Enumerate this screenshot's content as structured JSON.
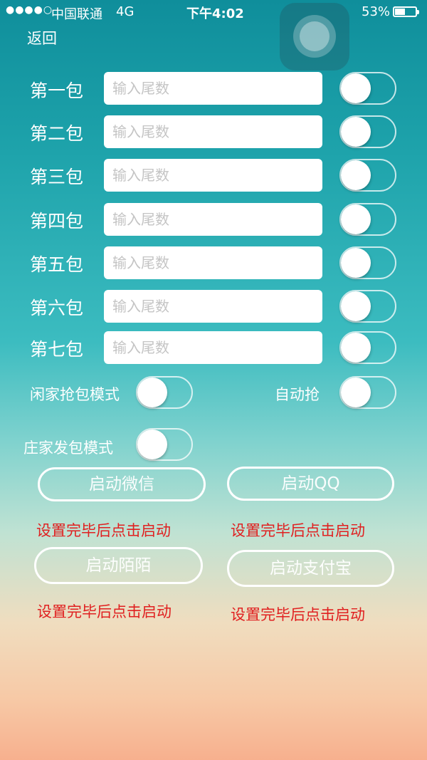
{
  "status_bar": {
    "signal": "●●●●○",
    "carrier": "中国联通",
    "network": "4G",
    "time": "下午4:02",
    "battery": "53%",
    "battery_level": 0.53
  },
  "nav": {
    "back_label": "返回"
  },
  "packets": [
    {
      "label": "第一包",
      "placeholder": "输入尾数",
      "enabled": false
    },
    {
      "label": "第二包",
      "placeholder": "输入尾数",
      "enabled": false
    },
    {
      "label": "第三包",
      "placeholder": "输入尾数",
      "enabled": false
    },
    {
      "label": "第四包",
      "placeholder": "输入尾数",
      "enabled": false
    },
    {
      "label": "第五包",
      "placeholder": "输入尾数",
      "enabled": false
    },
    {
      "label": "第六包",
      "placeholder": "输入尾数",
      "enabled": false
    },
    {
      "label": "第七包",
      "placeholder": "输入尾数",
      "enabled": false
    }
  ],
  "modes": {
    "idle_mode_label": "闲家抢包模式",
    "auto_grab_label": "自动抢",
    "banker_mode_label": "庄家发包模式"
  },
  "launch": {
    "wechat": {
      "label": "启动微信",
      "hint": "设置完毕后点击启动"
    },
    "qq": {
      "label": "启动QQ",
      "hint": "设置完毕后点击启动"
    },
    "momo": {
      "label": "启动陌陌",
      "hint": "设置完毕后点击启动"
    },
    "alipay": {
      "label": "启动支付宝",
      "hint": "设置完毕后点击启动"
    }
  },
  "colors": {
    "hint_red": "#e02020",
    "gradient_top": "#0f8e9b",
    "gradient_bottom": "#f7b08e"
  }
}
